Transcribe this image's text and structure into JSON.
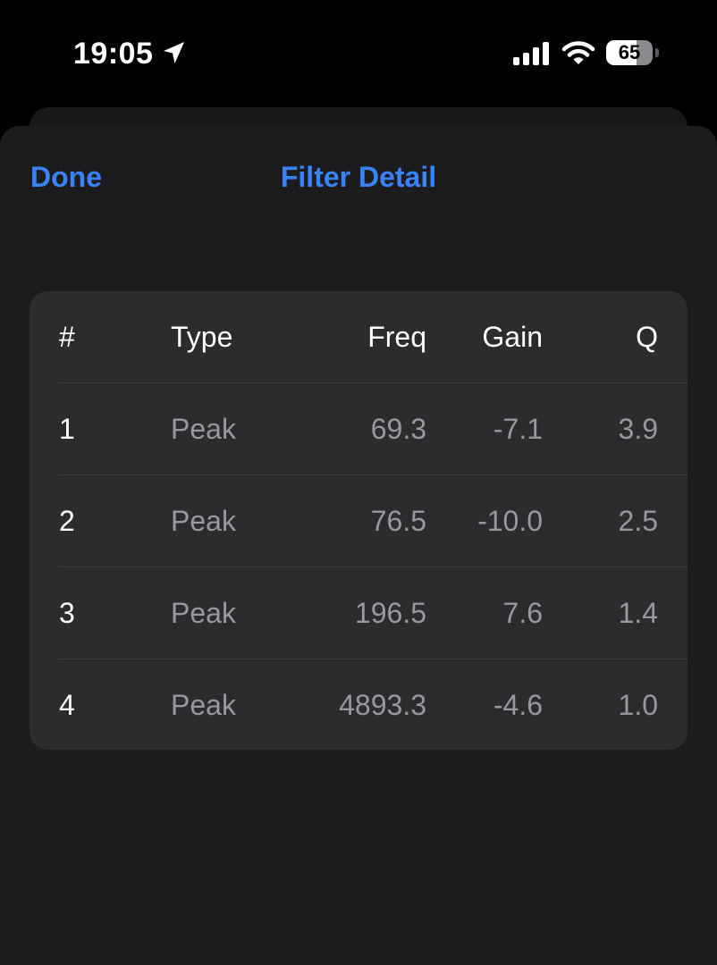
{
  "status_bar": {
    "time": "19:05",
    "battery_level": "65",
    "battery_fraction": 0.65,
    "icons": [
      "location-arrow-icon",
      "cellular-signal-icon",
      "wifi-icon",
      "battery-icon"
    ]
  },
  "nav": {
    "done_label": "Done",
    "title": "Filter Detail"
  },
  "table": {
    "columns": [
      "#",
      "Type",
      "Freq",
      "Gain",
      "Q"
    ],
    "rows": [
      {
        "num": "1",
        "type": "Peak",
        "freq": "69.3",
        "gain": "-7.1",
        "q": "3.9"
      },
      {
        "num": "2",
        "type": "Peak",
        "freq": "76.5",
        "gain": "-10.0",
        "q": "2.5"
      },
      {
        "num": "3",
        "type": "Peak",
        "freq": "196.5",
        "gain": "7.6",
        "q": "1.4"
      },
      {
        "num": "4",
        "type": "Peak",
        "freq": "4893.3",
        "gain": "-4.6",
        "q": "1.0"
      }
    ]
  },
  "colors": {
    "accent": "#3a82f7",
    "sheet_background": "#1c1c1e",
    "card_background": "#2c2c2e",
    "secondary_text": "#98989d"
  }
}
